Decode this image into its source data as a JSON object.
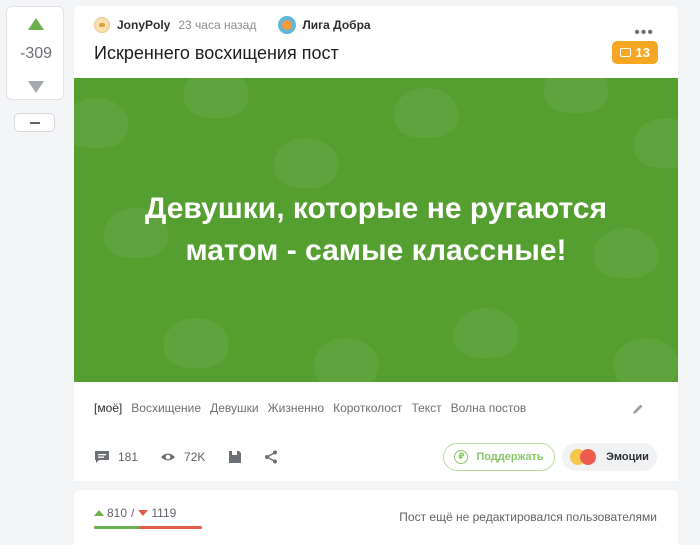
{
  "vote": {
    "score": "-309"
  },
  "story": {
    "author": "JonyPoly",
    "time": "23 часа назад",
    "community": "Лига Добра",
    "title": "Искреннего восхищения пост",
    "badge_count": "13",
    "image_caption_line1": "Девушки, которые не ругаются",
    "image_caption_line2": "матом - самые классные!",
    "tags": [
      "[моё]",
      "Восхищение",
      "Девушки",
      "Жизненно",
      "Коротколост",
      "Текст",
      "Волна постов"
    ],
    "comments": "181",
    "views": "72K",
    "support_label": "Поддержать",
    "emotions_label": "Эмоции"
  },
  "rating": {
    "pluses": "810",
    "separator": "/",
    "minuses": "1119",
    "plus_share": 0.42,
    "edited_note": "Пост ещё не редактировался пользователями"
  },
  "colors": {
    "accent_green": "#6ab04c",
    "image_green": "#559e30",
    "badge_orange": "#f5a623",
    "minus_red": "#e45b4c"
  }
}
